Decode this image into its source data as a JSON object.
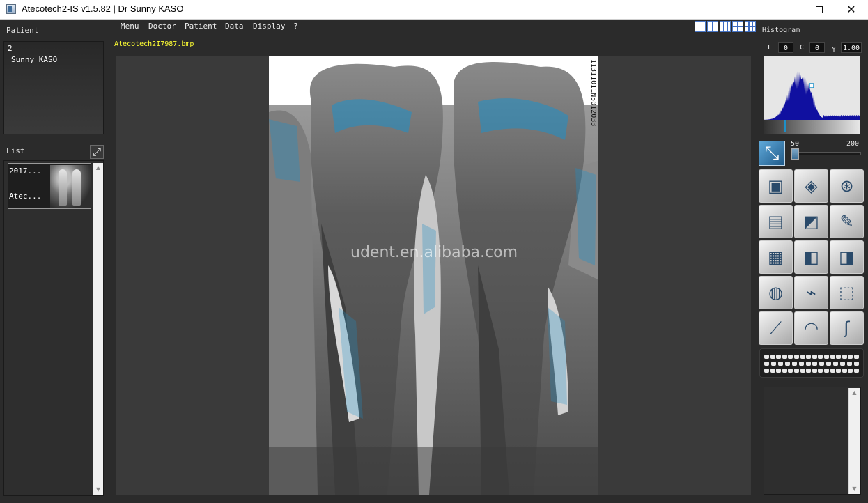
{
  "window": {
    "title": "Atecotech2-IS v1.5.82 | Dr Sunny KASO",
    "minimize_label": "",
    "maximize_label": "",
    "close_label": "✕"
  },
  "patient_panel": {
    "label": "Patient",
    "id": "2",
    "name": "Sunny KASO"
  },
  "list_panel": {
    "label": "List",
    "expand_icon": "⤢",
    "items": [
      {
        "date": "2017...",
        "name": "Atec..."
      }
    ]
  },
  "menu": {
    "items": [
      "Menu",
      "Doctor",
      "Patient",
      "Data",
      "Display",
      "?"
    ]
  },
  "layout_buttons": [
    "layout-1",
    "layout-2",
    "layout-3",
    "layout-2x2",
    "layout-3x2"
  ],
  "viewer": {
    "file_name": "Atecotech2I7987.bmp",
    "image_id": "11311011N5012033",
    "watermark": "udent.en.alibaba.com"
  },
  "histogram": {
    "label": "Histogram",
    "l_label": "L",
    "l_value": "0",
    "c_label": "C",
    "c_value": "0",
    "y_label": "Y",
    "y_value": "1.00",
    "slider_min": "50",
    "slider_max": "200",
    "accent_color": "#1e90c8",
    "bar_color": "#1010a0"
  },
  "tools": {
    "fit_icon": "fit-to-window-icon",
    "fit_glyph": "⤡",
    "items": [
      {
        "name": "emboss-tool",
        "glyph": "▣"
      },
      {
        "name": "eraser-tool",
        "glyph": "◈"
      },
      {
        "name": "bolt-tool",
        "glyph": "⊛"
      },
      {
        "name": "film-tool",
        "glyph": "▤"
      },
      {
        "name": "palette-tool",
        "glyph": "◩"
      },
      {
        "name": "pipette-tool",
        "glyph": "✎"
      },
      {
        "name": "texture-tool",
        "glyph": "▦"
      },
      {
        "name": "cube-compare-tool",
        "glyph": "◧"
      },
      {
        "name": "cube-split-tool",
        "glyph": "◨"
      },
      {
        "name": "cylinder-tool",
        "glyph": "◍"
      },
      {
        "name": "flashlight-tool",
        "glyph": "⌁"
      },
      {
        "name": "3d-view-tool",
        "glyph": "⬚"
      },
      {
        "name": "ruler-tool",
        "glyph": "⟋"
      },
      {
        "name": "protractor-tool",
        "glyph": "◠"
      },
      {
        "name": "probe-tool",
        "glyph": "ʃ"
      }
    ],
    "dental_chart_label": "dental-chart-icon"
  }
}
